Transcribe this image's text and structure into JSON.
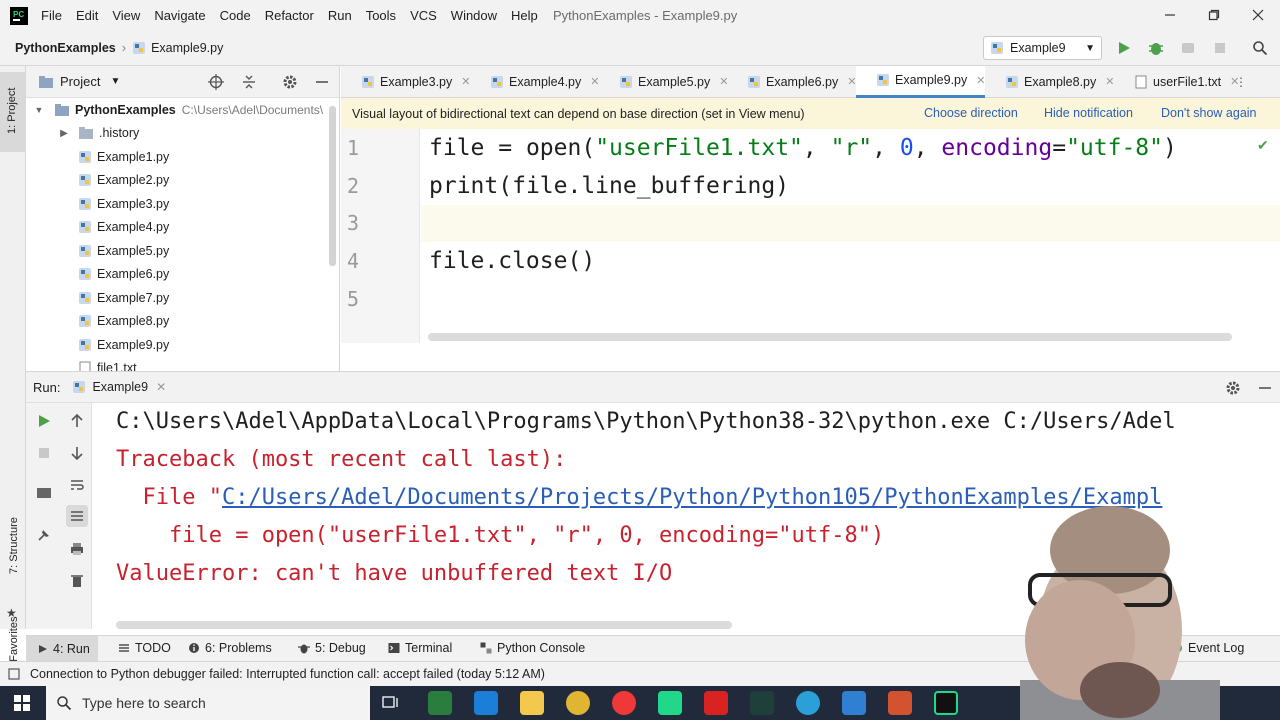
{
  "menubar": {
    "items": [
      "File",
      "Edit",
      "View",
      "Navigate",
      "Code",
      "Refactor",
      "Run",
      "Tools",
      "VCS",
      "Window",
      "Help"
    ],
    "window_title": "PythonExamples - Example9.py"
  },
  "navbar": {
    "project": "PythonExamples",
    "file": "Example9.py",
    "run_config": "Example9"
  },
  "project_panel": {
    "title": "Project",
    "root_name": "PythonExamples",
    "root_path": "C:\\Users\\Adel\\Documents\\",
    "items": [
      ".history",
      "Example1.py",
      "Example2.py",
      "Example3.py",
      "Example4.py",
      "Example5.py",
      "Example6.py",
      "Example7.py",
      "Example8.py",
      "Example9.py",
      "file1.txt"
    ]
  },
  "left_strip": {
    "project_label": "1: Project",
    "structure_label": "7: Structure",
    "favorites_label": "2: Favorites"
  },
  "editor": {
    "tabs": [
      "Example3.py",
      "Example4.py",
      "Example5.py",
      "Example6.py",
      "Example9.py",
      "Example8.py",
      "userFile1.txt"
    ],
    "active_tab": "Example9.py",
    "notification": {
      "text": "Visual layout of bidirectional text can depend on base direction (set in View menu)",
      "choose": "Choose direction",
      "hide": "Hide notification",
      "dont_show": "Don't show again"
    },
    "line_numbers": [
      "1",
      "2",
      "3",
      "4",
      "5"
    ],
    "lines": {
      "l1_a": "file = ",
      "l1_b": "open(",
      "l1_c": "\"userFile1.txt\"",
      "l1_d": ", ",
      "l1_e": "\"r\"",
      "l1_f": ", ",
      "l1_g": "0",
      "l1_h": ", ",
      "l1_i": "encoding",
      "l1_j": "=",
      "l1_k": "\"utf-8\"",
      "l1_l": ")",
      "l2_a": "print",
      "l2_b": "(file.line_buffering)",
      "l4": "file.close()"
    }
  },
  "run_panel": {
    "label": "Run:",
    "tab": "Example9",
    "console": {
      "line1": "C:\\Users\\Adel\\AppData\\Local\\Programs\\Python\\Python38-32\\python.exe C:/Users/Adel",
      "line2": "Traceback (most recent call last):",
      "line3_prefix": "  File \"",
      "line3_link": "C:/Users/Adel/Documents/Projects/Python/Python105/PythonExamples/Exampl",
      "line4": "    file = open(\"userFile1.txt\", \"r\", 0, encoding=\"utf-8\")",
      "line5": "ValueError: can't have unbuffered text I/O"
    }
  },
  "tool_windows": {
    "run": "4: Run",
    "todo": "TODO",
    "problems": "6: Problems",
    "debug": "5: Debug",
    "terminal": "Terminal",
    "console": "Python Console",
    "event_log": "Event Log"
  },
  "status": {
    "message": "Connection to Python debugger failed: Interrupted function call: accept failed (today 5:12 AM)"
  },
  "taskbar": {
    "search_placeholder": "Type here to search"
  },
  "colors": {
    "accent": "#4083c9",
    "error": "#c7222d",
    "link": "#2a5eb8",
    "string": "#067d17",
    "number": "#1750eb"
  }
}
